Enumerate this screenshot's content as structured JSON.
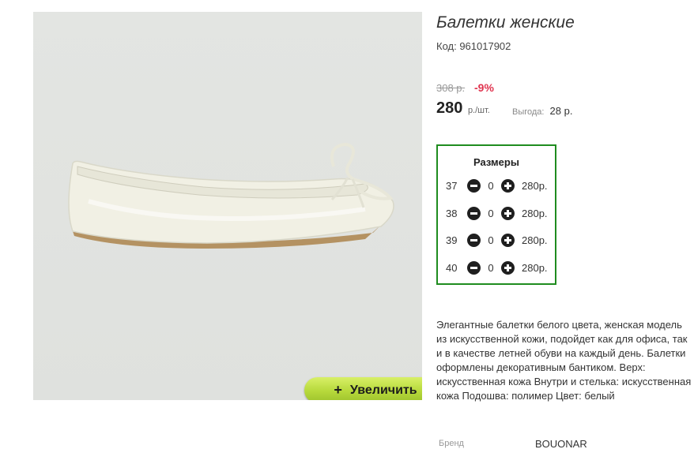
{
  "product": {
    "title": "Балетки женские",
    "code": "Код: 961017902",
    "image_alt": "white ballet flat shoe with bow",
    "zoom_label": "Увеличить",
    "zoom_plus": "+"
  },
  "pricing": {
    "old_price": "308 р.",
    "discount": "-9%",
    "price": "280",
    "price_unit": "р./шт.",
    "saving_label": "Выгода:",
    "saving_value": "28 р."
  },
  "sizes": {
    "header": "Размеры",
    "rows": [
      {
        "size": "37",
        "qty": "0",
        "price": "280р."
      },
      {
        "size": "38",
        "qty": "0",
        "price": "280р."
      },
      {
        "size": "39",
        "qty": "0",
        "price": "280р."
      },
      {
        "size": "40",
        "qty": "0",
        "price": "280р."
      }
    ]
  },
  "description": "Элегантные балетки белого цвета, женская модель из искусственной кожи, подойдет как для офиса, так и в качестве летней обуви на каждый день. Балетки оформлены декоративным бантиком. Верх: искусственная кожа Внутри и стелька: искусственная кожа Подошва: полимер Цвет: белый",
  "brand": {
    "label": "Бренд",
    "value": "BOUONAR"
  },
  "colors": {
    "border_green": "#1f8c1f",
    "discount_red": "#e0344f",
    "button_green": "#b6d83a"
  }
}
